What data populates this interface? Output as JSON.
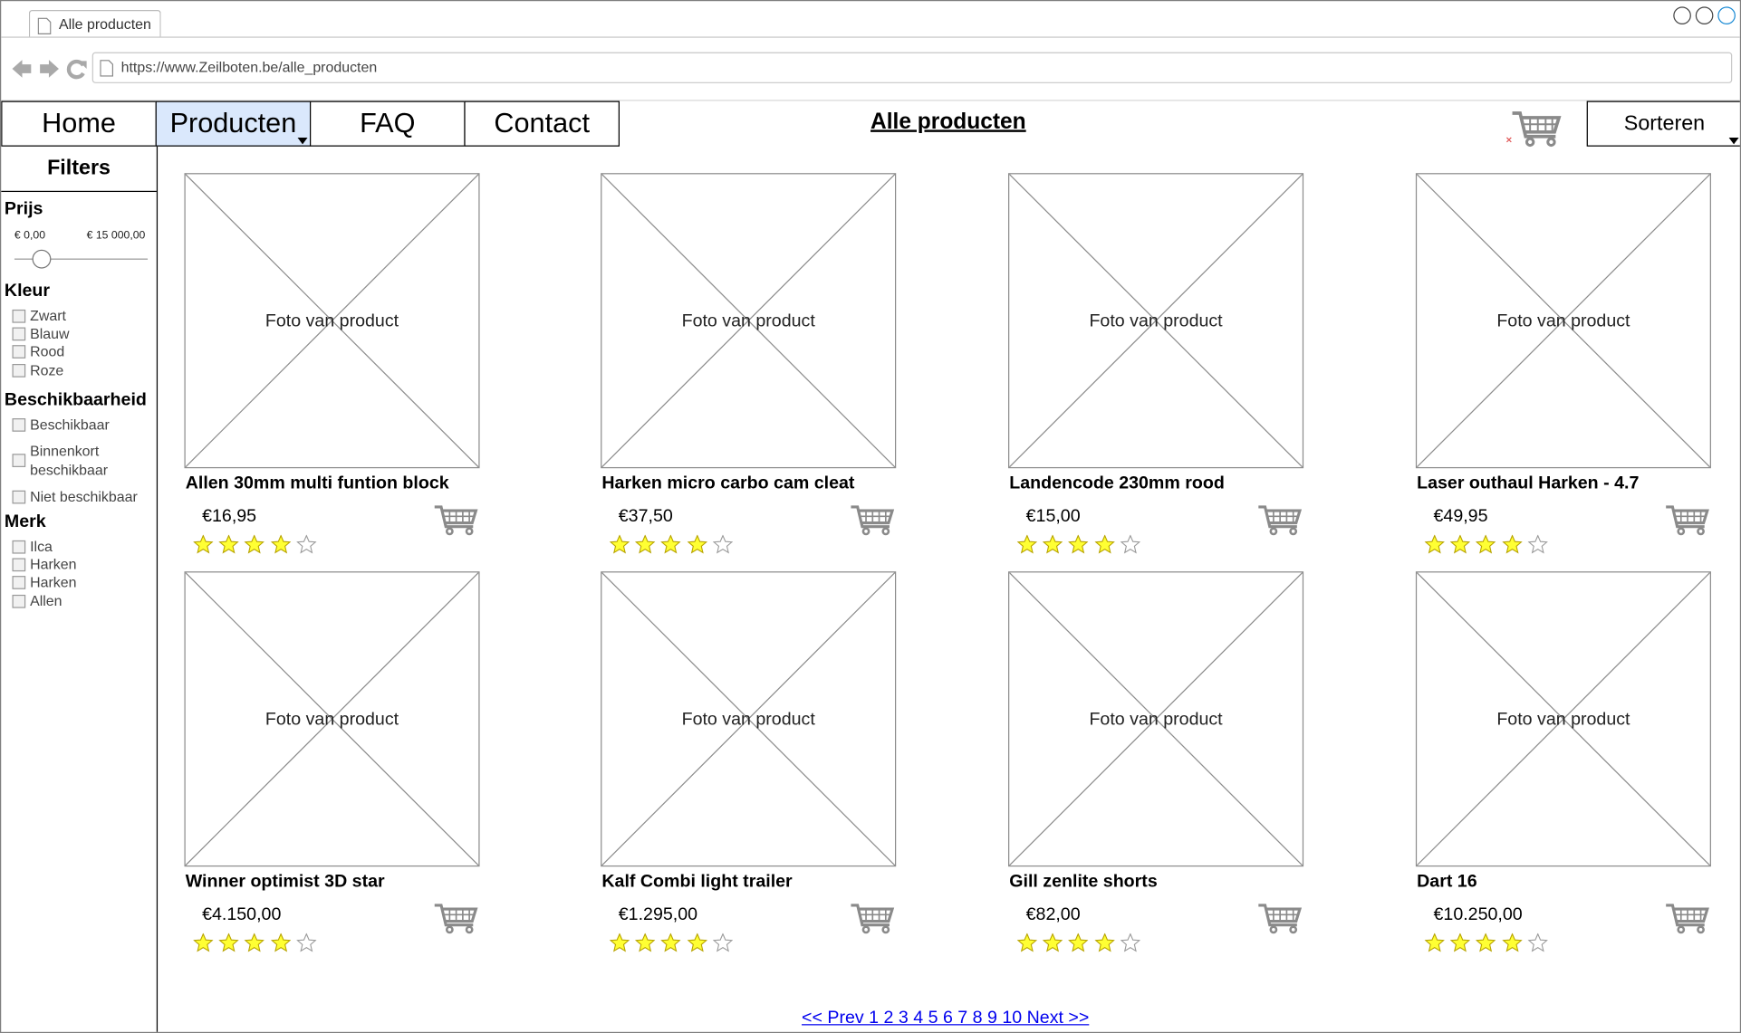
{
  "browser": {
    "tab_title": "Alle producten",
    "url": "https://www.Zeilboten.be/alle_producten"
  },
  "menu": {
    "home": "Home",
    "producten": "Producten",
    "faq": "FAQ",
    "contact": "Contact"
  },
  "page_title": "Alle producten",
  "sort_label": "Sorteren",
  "sidebar": {
    "title": "Filters",
    "price": {
      "title": "Prijs",
      "min": "€ 0,00",
      "max": "€ 15 000,00"
    },
    "color": {
      "title": "Kleur",
      "options": [
        "Zwart",
        "Blauw",
        "Rood",
        "Roze"
      ]
    },
    "availability": {
      "title": "Beschikbaarheid",
      "options": [
        "Beschikbaar",
        "Binnenkort beschikbaar",
        "Niet beschikbaar"
      ]
    },
    "brand": {
      "title": "Merk",
      "options": [
        "Ilca",
        "Harken",
        "Harken",
        "Allen"
      ]
    }
  },
  "products": [
    {
      "photo_label": "Foto van product",
      "name": "Allen 30mm multi funtion block",
      "price": "€16,95",
      "rating": 4
    },
    {
      "photo_label": "Foto van product",
      "name": "Harken micro carbo cam cleat",
      "price": "€37,50",
      "rating": 4
    },
    {
      "photo_label": "Foto van product",
      "name": "Landencode 230mm rood",
      "price": "€15,00",
      "rating": 4
    },
    {
      "photo_label": "Foto van product",
      "name": "Laser outhaul Harken - 4.7",
      "price": "€49,95",
      "rating": 4
    },
    {
      "photo_label": "Foto van product",
      "name": "Winner optimist 3D star",
      "price": "€4.150,00",
      "rating": 4
    },
    {
      "photo_label": "Foto van product",
      "name": "Kalf Combi light trailer",
      "price": "€1.295,00",
      "rating": 4
    },
    {
      "photo_label": "Foto van product",
      "name": "Gill zenlite shorts",
      "price": "€82,00",
      "rating": 4
    },
    {
      "photo_label": "Foto van product",
      "name": "Dart 16",
      "price": "€10.250,00",
      "rating": 4
    }
  ],
  "pagination": "<< Prev 1 2 3 4 5 6 7 8 9 10 Next >>",
  "colors": {
    "star": "#ffff33",
    "active_tab": "#dae8fc",
    "link": "#0000ee"
  }
}
